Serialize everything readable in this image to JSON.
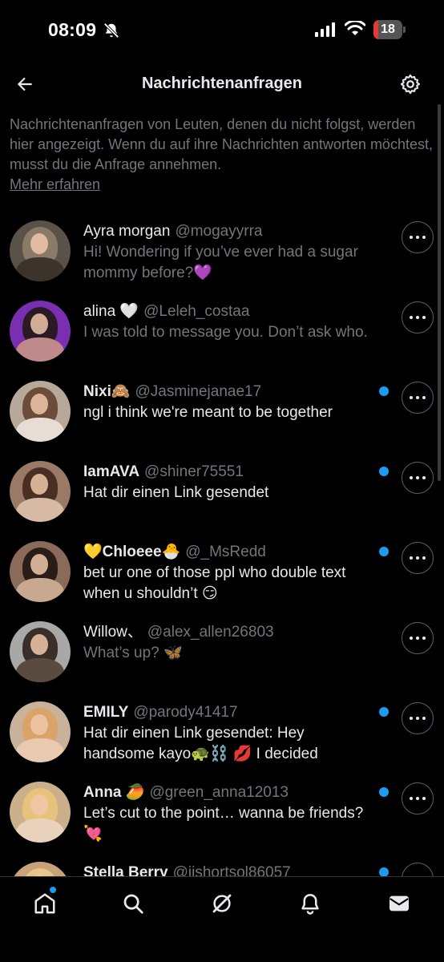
{
  "status_bar": {
    "time": "08:09",
    "battery": "18",
    "battery_level": 0.18
  },
  "header": {
    "title": "Nachrichtenanfragen"
  },
  "intro": {
    "text": "Nachrichtenanfragen von Leuten, denen du nicht folgst, werden hier angezeigt. Wenn du auf ihre Nachrichten antworten möchtest, musst du die Anfrage annehmen.",
    "link": "Mehr erfahren"
  },
  "requests": [
    {
      "name": "Ayra morgan",
      "handle": "@mogayyrra",
      "message": "Hi! Wondering if you’ve ever had a sugar mommy before?💜",
      "unread": false,
      "avatar_colors": [
        "#5a5148",
        "#8a7a68",
        "#3c332b"
      ]
    },
    {
      "name": "alina 🤍",
      "handle": "@Leleh_costaa",
      "message": "I was told to message you. Don’t ask who.",
      "unread": false,
      "avatar_colors": [
        "#7a2fb0",
        "#2b1a24",
        "#c08a8a"
      ]
    },
    {
      "name": "Nixi🙈",
      "handle": "@Jasminejanae17",
      "message": "ngl i think we're meant to be together",
      "unread": true,
      "avatar_colors": [
        "#b8a89a",
        "#6b4c3b",
        "#e8ddd5"
      ]
    },
    {
      "name": "IamAVA",
      "handle": "@shiner75551",
      "message": "Hat dir einen Link gesendet",
      "unread": true,
      "avatar_colors": [
        "#9a7a66",
        "#4a2e24",
        "#d8b9a4"
      ]
    },
    {
      "name": "💛Chloeee🐣",
      "handle": "@_MsRedd",
      "message": "bet ur one of those ppl who double text when u shouldn’t 😏",
      "unread": true,
      "avatar_colors": [
        "#8a6a58",
        "#2a1c16",
        "#c9a890"
      ]
    },
    {
      "name": "Willow、",
      "handle": "@alex_allen26803",
      "message": "What’s up? 🦋",
      "unread": false,
      "avatar_colors": [
        "#a8a8a8",
        "#3a2e28",
        "#5a4a40"
      ]
    },
    {
      "name": "EMILY",
      "handle": "@parody41417",
      "message": "Hat dir einen Link gesendet: Hey handsome kayo🐢⛓️ 💋 I decided",
      "unread": true,
      "avatar_colors": [
        "#c8b29a",
        "#d9a36a",
        "#e9c9b0"
      ]
    },
    {
      "name": "Anna 🥭",
      "handle": "@green_anna12013",
      "message": "Let’s cut to the point… wanna be friends? 💘",
      "unread": true,
      "avatar_colors": [
        "#c9b08a",
        "#e6c27a",
        "#e9d2bc"
      ]
    },
    {
      "name": "Stella Berry",
      "handle": "@iishortsol86057",
      "message": "",
      "unread": true,
      "avatar_colors": [
        "#c9a27a",
        "#e8c48a",
        "#e9d2bc"
      ]
    }
  ],
  "nav": {
    "items": [
      "home-icon",
      "search-icon",
      "grok-icon",
      "notifications-icon",
      "messages-icon"
    ],
    "home_has_dot": true
  }
}
